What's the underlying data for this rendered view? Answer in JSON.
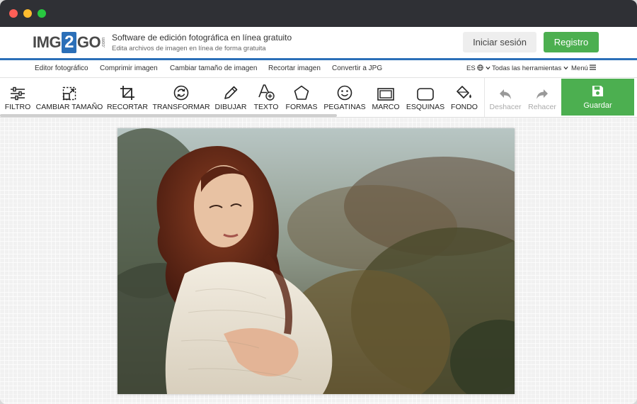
{
  "window": {
    "controls": [
      "close",
      "minimize",
      "zoom"
    ]
  },
  "header": {
    "logo": {
      "part1": "IMG",
      "part2": "2",
      "part3": "GO",
      "suffix": ".com"
    },
    "tagline_title": "Software de edición fotográfica en línea gratuito",
    "tagline_sub": "Edita archivos de imagen en línea de forma gratuita",
    "login_label": "Iniciar sesión",
    "register_label": "Registro",
    "accent": "#2b6fb8",
    "green": "#4caf50"
  },
  "nav": {
    "items": [
      "Editor fotográfico",
      "Comprimir imagen",
      "Cambiar tamaño de imagen",
      "Recortar imagen",
      "Convertir a JPG"
    ],
    "language": "ES",
    "all_tools": "Todas las herramientas",
    "menu": "Menú"
  },
  "toolbar": {
    "tools": [
      {
        "label": "FILTRO",
        "icon": "sliders-icon"
      },
      {
        "label": "CAMBIAR TAMAÑO",
        "icon": "resize-icon"
      },
      {
        "label": "RECORTAR",
        "icon": "crop-icon"
      },
      {
        "label": "TRANSFORMAR",
        "icon": "rotate-icon"
      },
      {
        "label": "DIBUJAR",
        "icon": "pencil-icon"
      },
      {
        "label": "TEXTO",
        "icon": "text-add-icon"
      },
      {
        "label": "FORMAS",
        "icon": "pentagon-icon"
      },
      {
        "label": "PEGATINAS",
        "icon": "smiley-icon"
      },
      {
        "label": "MARCO",
        "icon": "frame-icon"
      },
      {
        "label": "ESQUINAS",
        "icon": "rounded-corners-icon"
      },
      {
        "label": "FONDO",
        "icon": "paint-bucket-icon"
      }
    ],
    "undo_label": "Deshacer",
    "redo_label": "Rehacer",
    "save_label": "Guardar"
  },
  "canvas": {
    "image_subject": "photo"
  }
}
